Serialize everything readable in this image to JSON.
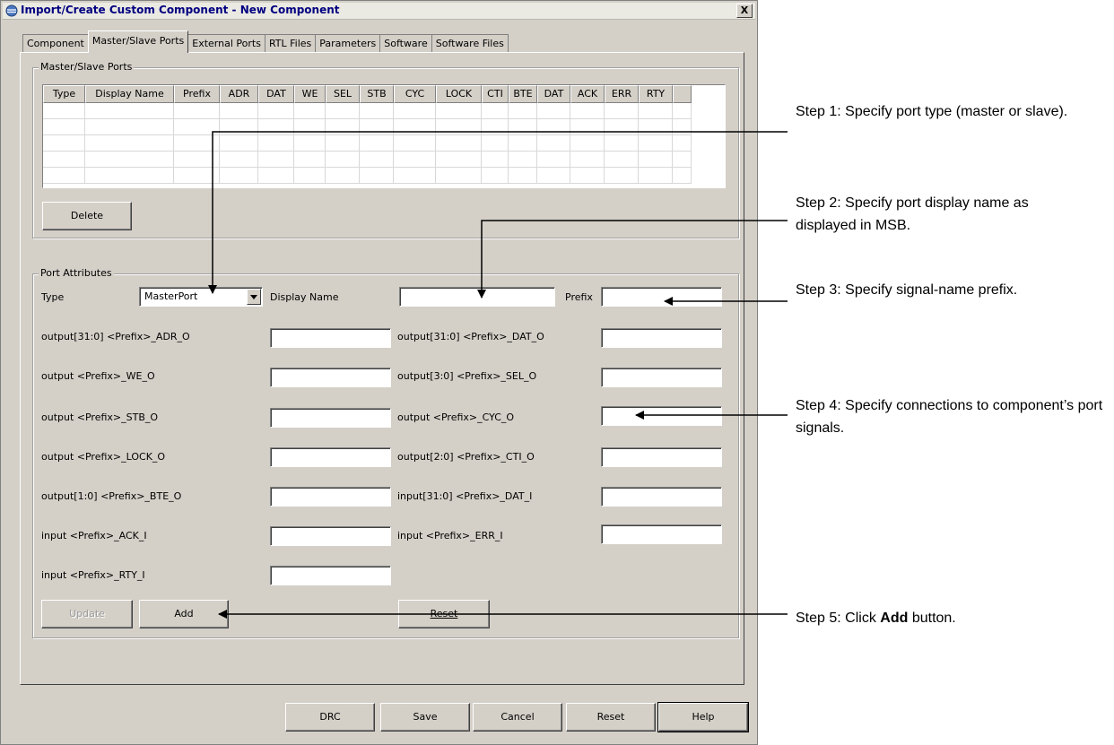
{
  "window": {
    "title": "Import/Create Custom Component - New Component",
    "close_label": "X"
  },
  "tabs": [
    {
      "label": "Component"
    },
    {
      "label": "Master/Slave Ports"
    },
    {
      "label": "External Ports"
    },
    {
      "label": "RTL Files"
    },
    {
      "label": "Parameters"
    },
    {
      "label": "Software"
    },
    {
      "label": "Software Files"
    }
  ],
  "ms_ports": {
    "group_title": "Master/Slave Ports",
    "columns": [
      "Type",
      "Display Name",
      "Prefix",
      "ADR",
      "DAT",
      "WE",
      "SEL",
      "STB",
      "CYC",
      "LOCK",
      "CTI",
      "BTE",
      "DAT",
      "ACK",
      "ERR",
      "RTY"
    ],
    "delete_label": "Delete"
  },
  "attributes": {
    "group_title": "Port Attributes",
    "type_label": "Type",
    "type_value": "MasterPort",
    "display_name_label": "Display Name",
    "display_name_value": "",
    "prefix_label": "Prefix",
    "prefix_value": "",
    "signals_left": [
      {
        "label": "output[31:0] <Prefix>_ADR_O",
        "value": ""
      },
      {
        "label": "output <Prefix>_WE_O",
        "value": ""
      },
      {
        "label": "output <Prefix>_STB_O",
        "value": ""
      },
      {
        "label": "output <Prefix>_LOCK_O",
        "value": ""
      },
      {
        "label": "output[1:0] <Prefix>_BTE_O",
        "value": ""
      },
      {
        "label": "input <Prefix>_ACK_I",
        "value": ""
      },
      {
        "label": "input <Prefix>_RTY_I",
        "value": ""
      }
    ],
    "signals_right": [
      {
        "label": "output[31:0] <Prefix>_DAT_O",
        "value": ""
      },
      {
        "label": "output[3:0] <Prefix>_SEL_O",
        "value": ""
      },
      {
        "label": "output <Prefix>_CYC_O",
        "value": ""
      },
      {
        "label": "output[2:0] <Prefix>_CTI_O",
        "value": ""
      },
      {
        "label": "input[31:0] <Prefix>_DAT_I",
        "value": ""
      },
      {
        "label": "input <Prefix>_ERR_I",
        "value": ""
      }
    ],
    "update_label": "Update",
    "add_label": "Add",
    "reset_label": "Reset"
  },
  "footer": {
    "drc": "DRC",
    "save": "Save",
    "cancel": "Cancel",
    "reset": "Reset",
    "help": "Help"
  },
  "annotations": {
    "step1": "Step 1: Specify port type (master or slave).",
    "step2": "Step 2: Specify port display name as displayed in MSB.",
    "step3": "Step 3: Specify signal-name prefix.",
    "step4": "Step 4: Specify connections to component’s port signals.",
    "step5_prefix": "Step 5: Click ",
    "step5_bold": "Add",
    "step5_suffix": " button."
  }
}
